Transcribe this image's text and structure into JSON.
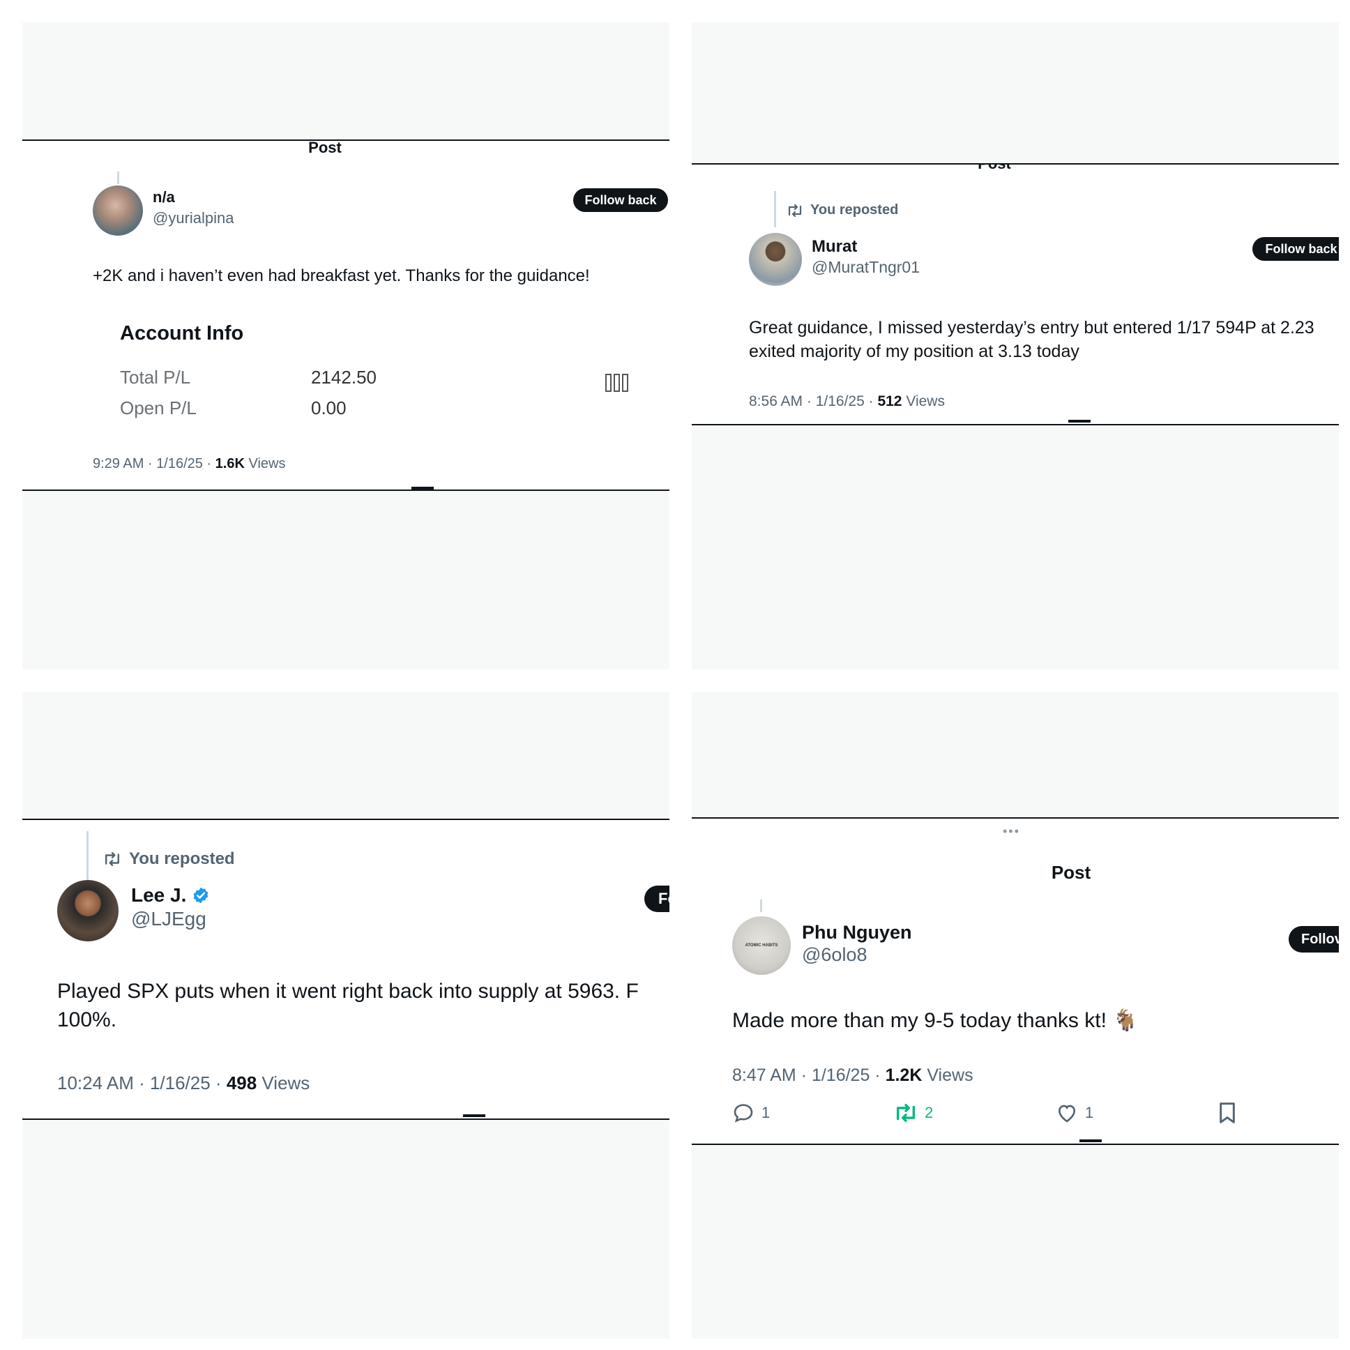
{
  "panels": [
    {
      "header": "Post",
      "user": {
        "name": "n/a",
        "handle": "@yurialpina"
      },
      "follow_label": "Follow back",
      "text": "+2K and i haven’t even had breakfast yet. Thanks for the guidance!",
      "account": {
        "title": "Account Info",
        "rows": [
          {
            "label": "Total P/L",
            "value": "2142.50"
          },
          {
            "label": "Open P/L",
            "value": "0.00"
          }
        ]
      },
      "meta": {
        "time": "9:29 AM · 1/16/25 · ",
        "views_count": "1.6K",
        "views_label": " Views"
      }
    },
    {
      "header": "Post",
      "reposted": "You reposted",
      "user": {
        "name": "Murat",
        "handle": "@MuratTngr01"
      },
      "follow_label": "Follow back",
      "text": "Great guidance, I missed yesterday’s entry but entered 1/17 594P at 2.23 exited majority of my position at 3.13 today",
      "meta": {
        "time": "8:56 AM · 1/16/25 · ",
        "views_count": "512",
        "views_label": " Views"
      }
    },
    {
      "reposted": "You reposted",
      "user": {
        "name": "Lee J.",
        "handle": "@LJEgg"
      },
      "follow_label": "Fo",
      "text": "Played SPX puts when it went right back into supply at 5963. F 100%.",
      "meta": {
        "time": "10:24 AM · 1/16/25 · ",
        "views_count": "498",
        "views_label": " Views"
      }
    },
    {
      "header": "Post",
      "more": "•••",
      "user": {
        "name": "Phu Nguyen",
        "handle": "@6olo8"
      },
      "follow_label": "Follov",
      "avatar_text": "ATOMIC HABITS",
      "text": "Made more than my 9-5 today thanks kt! 🐐",
      "meta": {
        "time": "8:47 AM · 1/16/25 · ",
        "views_count": "1.2K",
        "views_label": " Views"
      },
      "actions": {
        "replies": "1",
        "reposts": "2",
        "likes": "1"
      },
      "colors": {
        "repost_active": "#00ba7c"
      }
    }
  ]
}
